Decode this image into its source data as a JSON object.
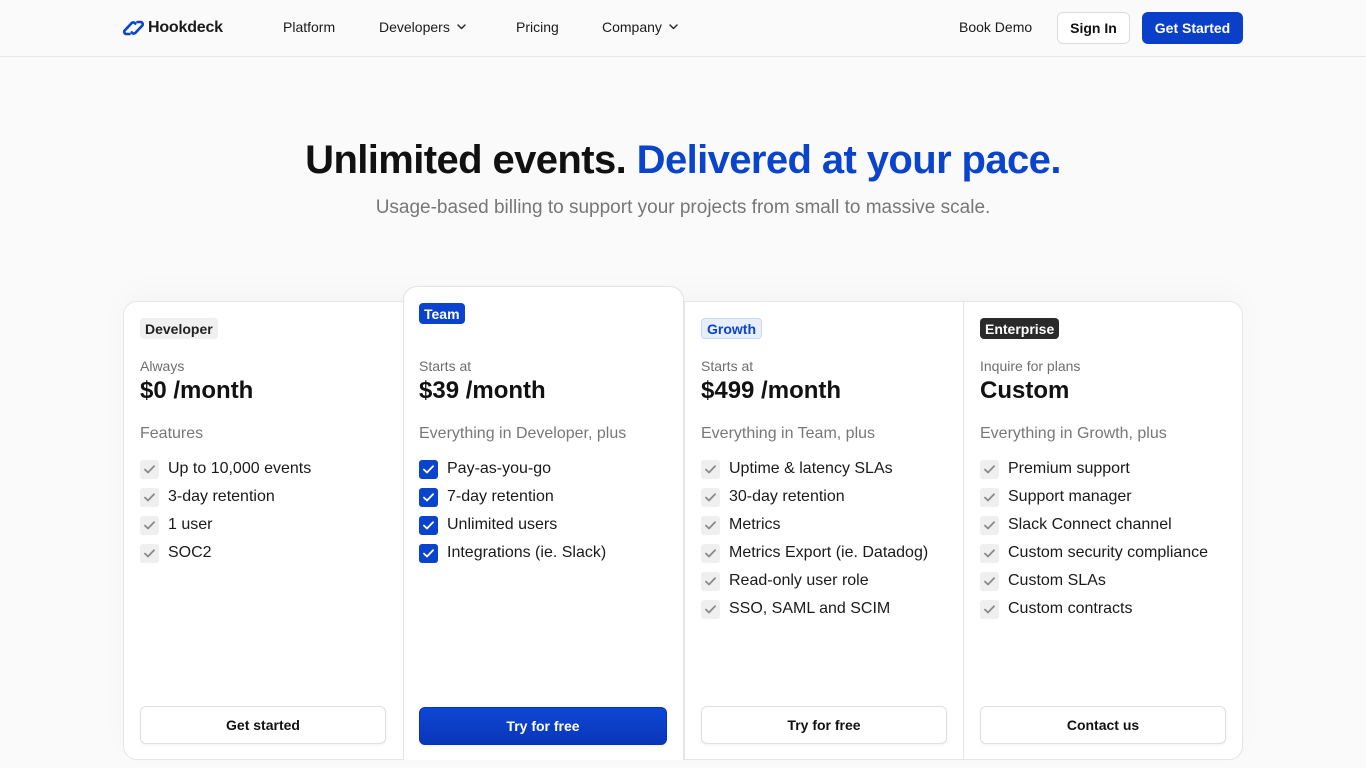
{
  "nav": {
    "brand": "Hookdeck",
    "links": [
      {
        "label": "Platform",
        "dropdown": false
      },
      {
        "label": "Developers",
        "dropdown": true
      },
      {
        "label": "Pricing",
        "dropdown": false
      },
      {
        "label": "Company",
        "dropdown": true
      }
    ],
    "book_demo": "Book Demo",
    "sign_in": "Sign In",
    "get_started": "Get Started"
  },
  "hero": {
    "title_main": "Unlimited events.",
    "title_accent": "Delivered at your pace.",
    "subtitle": "Usage-based billing to support your projects from small to massive scale."
  },
  "plans": [
    {
      "badge": "Developer",
      "pre": "Always",
      "price": "$0 /month",
      "features_heading": "Features",
      "features": [
        "Up to 10,000 events",
        "3-day retention",
        "1 user",
        "SOC2"
      ],
      "cta": "Get started"
    },
    {
      "badge": "Team",
      "pre": "Starts at",
      "price": "$39 /month",
      "features_heading": "Everything in Developer, plus",
      "features": [
        "Pay-as-you-go",
        "7-day retention",
        "Unlimited users",
        "Integrations (ie. Slack)"
      ],
      "cta": "Try for free"
    },
    {
      "badge": "Growth",
      "pre": "Starts at",
      "price": "$499 /month",
      "features_heading": "Everything in Team, plus",
      "features": [
        "Uptime & latency SLAs",
        "30-day retention",
        "Metrics",
        "Metrics Export (ie. Datadog)",
        "Read-only user role",
        "SSO, SAML and SCIM"
      ],
      "cta": "Try for free"
    },
    {
      "badge": "Enterprise",
      "pre": "Inquire for plans",
      "price": "Custom",
      "features_heading": "Everything in Growth, plus",
      "features": [
        "Premium support",
        "Support manager",
        "Slack Connect channel",
        "Custom security compliance",
        "Custom SLAs",
        "Custom contracts"
      ],
      "cta": "Contact us"
    }
  ],
  "colors": {
    "accent": "#0b44cc",
    "primary_button": "#0a3fc9",
    "muted_text": "#777777",
    "background": "#fafafa"
  },
  "icons": {
    "logo": "hookdeck-link-logo",
    "check": "check-icon",
    "dropdown": "chevron-down-icon"
  }
}
